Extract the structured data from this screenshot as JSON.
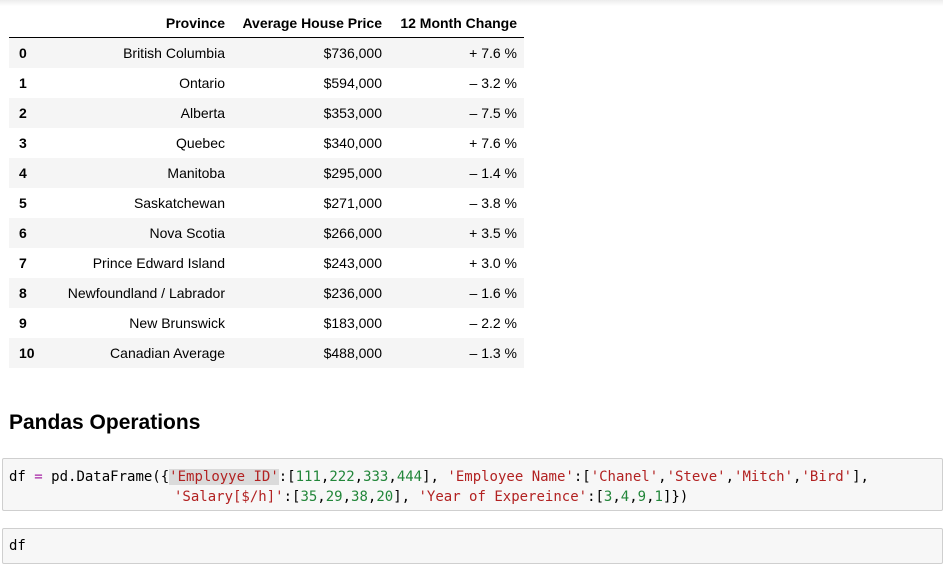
{
  "table": {
    "columns": [
      "",
      "Province",
      "Average House Price",
      "12 Month Change"
    ],
    "rows": [
      {
        "index": "0",
        "province": "British Columbia",
        "price": "$736,000",
        "change": "+ 7.6 %"
      },
      {
        "index": "1",
        "province": "Ontario",
        "price": "$594,000",
        "change": "– 3.2 %"
      },
      {
        "index": "2",
        "province": "Alberta",
        "price": "$353,000",
        "change": "– 7.5 %"
      },
      {
        "index": "3",
        "province": "Quebec",
        "price": "$340,000",
        "change": "+ 7.6 %"
      },
      {
        "index": "4",
        "province": "Manitoba",
        "price": "$295,000",
        "change": "– 1.4 %"
      },
      {
        "index": "5",
        "province": "Saskatchewan",
        "price": "$271,000",
        "change": "– 3.8 %"
      },
      {
        "index": "6",
        "province": "Nova Scotia",
        "price": "$266,000",
        "change": "+ 3.5 %"
      },
      {
        "index": "7",
        "province": "Prince Edward Island",
        "price": "$243,000",
        "change": "+ 3.0 %"
      },
      {
        "index": "8",
        "province": "Newfoundland / Labrador",
        "price": "$236,000",
        "change": "– 1.6 %"
      },
      {
        "index": "9",
        "province": "New Brunswick",
        "price": "$183,000",
        "change": "– 2.2 %"
      },
      {
        "index": "10",
        "province": "Canadian Average",
        "price": "$488,000",
        "change": "– 1.3 %"
      }
    ]
  },
  "section": {
    "title": "Pandas Operations"
  },
  "cells": {
    "code1": {
      "line1": [
        {
          "t": "df ",
          "c": "plain"
        },
        {
          "t": "=",
          "c": "op"
        },
        {
          "t": " pd.DataFrame({",
          "c": "plain"
        },
        {
          "t": "'Employye ID'",
          "c": "str",
          "hl": true
        },
        {
          "t": ":[",
          "c": "plain"
        },
        {
          "t": "111",
          "c": "num"
        },
        {
          "t": ",",
          "c": "plain"
        },
        {
          "t": "222",
          "c": "num"
        },
        {
          "t": ",",
          "c": "plain"
        },
        {
          "t": "333",
          "c": "num"
        },
        {
          "t": ",",
          "c": "plain"
        },
        {
          "t": "444",
          "c": "num"
        },
        {
          "t": "], ",
          "c": "plain"
        },
        {
          "t": "'Employee Name'",
          "c": "str"
        },
        {
          "t": ":[",
          "c": "plain"
        },
        {
          "t": "'Chanel'",
          "c": "str"
        },
        {
          "t": ",",
          "c": "plain"
        },
        {
          "t": "'Steve'",
          "c": "str"
        },
        {
          "t": ",",
          "c": "plain"
        },
        {
          "t": "'Mitch'",
          "c": "str"
        },
        {
          "t": ",",
          "c": "plain"
        },
        {
          "t": "'Bird'",
          "c": "str"
        },
        {
          "t": "],",
          "c": "plain"
        }
      ],
      "line2": [
        {
          "t": "'Salary[$/h]'",
          "c": "str"
        },
        {
          "t": ":[",
          "c": "plain"
        },
        {
          "t": "35",
          "c": "num"
        },
        {
          "t": ",",
          "c": "plain"
        },
        {
          "t": "29",
          "c": "num"
        },
        {
          "t": ",",
          "c": "plain"
        },
        {
          "t": "38",
          "c": "num"
        },
        {
          "t": ",",
          "c": "plain"
        },
        {
          "t": "20",
          "c": "num"
        },
        {
          "t": "], ",
          "c": "plain"
        },
        {
          "t": "'Year of Expereince'",
          "c": "str"
        },
        {
          "t": ":[",
          "c": "plain"
        },
        {
          "t": "3",
          "c": "num"
        },
        {
          "t": ",",
          "c": "plain"
        },
        {
          "t": "4",
          "c": "num"
        },
        {
          "t": ",",
          "c": "plain"
        },
        {
          "t": "9",
          "c": "num"
        },
        {
          "t": ",",
          "c": "plain"
        },
        {
          "t": "1",
          "c": "num"
        },
        {
          "t": "]})",
          "c": "plain"
        }
      ]
    },
    "code2": {
      "text": "df"
    }
  }
}
